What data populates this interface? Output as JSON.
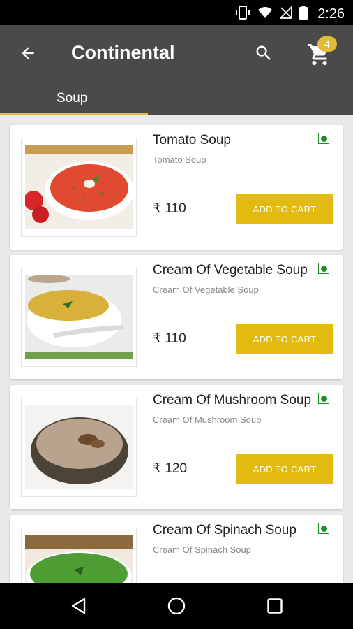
{
  "status_bar": {
    "time": "2:26"
  },
  "app_bar": {
    "title": "Continental",
    "cart_count": "4",
    "active_tab": "Soup"
  },
  "colors": {
    "accent": "#e3bb10",
    "app_bar": "#4a4a4a",
    "veg": "#1d8f2a"
  },
  "items": [
    {
      "name": "Tomato Soup",
      "desc": "Tomato Soup",
      "price": "₹ 110",
      "button": "ADD TO CART",
      "image": "tomato-soup"
    },
    {
      "name": "Cream Of Vegetable Soup",
      "desc": "Cream Of Vegetable Soup",
      "price": "₹ 110",
      "button": "ADD TO CART",
      "image": "vegetable-soup"
    },
    {
      "name": "Cream Of Mushroom Soup",
      "desc": "Cream Of Mushroom Soup",
      "price": "₹ 120",
      "button": "ADD TO CART",
      "image": "mushroom-soup"
    },
    {
      "name": "Cream Of Spinach Soup",
      "desc": "Cream Of Spinach Soup",
      "price": "",
      "button": "",
      "image": "spinach-soup"
    }
  ]
}
